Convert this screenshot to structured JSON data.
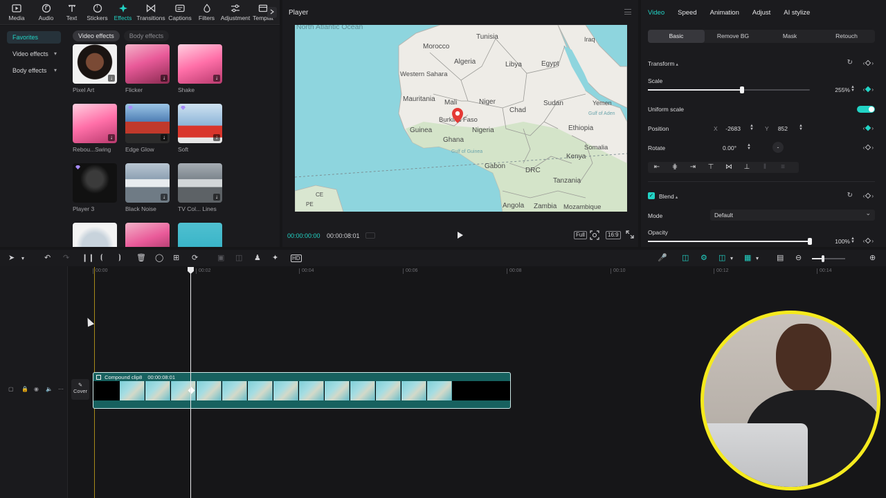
{
  "toolbar": {
    "items": [
      {
        "label": "Media",
        "icon": "media-icon"
      },
      {
        "label": "Audio",
        "icon": "audio-icon"
      },
      {
        "label": "Text",
        "icon": "text-icon"
      },
      {
        "label": "Stickers",
        "icon": "stickers-icon"
      },
      {
        "label": "Effects",
        "icon": "effects-icon",
        "active": true
      },
      {
        "label": "Transitions",
        "icon": "transitions-icon"
      },
      {
        "label": "Captions",
        "icon": "captions-icon"
      },
      {
        "label": "Filters",
        "icon": "filters-icon"
      },
      {
        "label": "Adjustment",
        "icon": "adjustment-icon"
      },
      {
        "label": "Templat",
        "icon": "templates-icon"
      }
    ]
  },
  "categories": {
    "favorites": "Favorites",
    "video_effects": "Video effects",
    "body_effects": "Body effects"
  },
  "effects": {
    "tabs": {
      "video": "Video effects",
      "body": "Body effects"
    },
    "items": [
      {
        "name": "Pixel Art"
      },
      {
        "name": "Flicker"
      },
      {
        "name": "Shake"
      },
      {
        "name": "Rebou...Swing"
      },
      {
        "name": "Edge Glow"
      },
      {
        "name": "Soft"
      },
      {
        "name": "Player 3"
      },
      {
        "name": "Black Noise"
      },
      {
        "name": "TV Col... Lines"
      },
      {
        "name": ""
      },
      {
        "name": ""
      },
      {
        "name": ""
      }
    ]
  },
  "player": {
    "title": "Player",
    "current_time": "00:00:00:00",
    "duration": "00:00:08:01",
    "buttons": {
      "full": "Full",
      "ratio": "16:9"
    },
    "map_labels": {
      "ocean": "North Atlantic Ocean",
      "tunisia": "Tunisia",
      "iraq": "Iraq",
      "morocco": "Morocco",
      "algeria": "Algeria",
      "libya": "Libya",
      "egypt": "Egypt",
      "western_sahara": "Western Sahara",
      "mauritania": "Mauritania",
      "mali": "Mali",
      "niger": "Niger",
      "chad": "Chad",
      "sudan": "Sudan",
      "yemen": "Yemen",
      "gulf_aden": "Gulf of Aden",
      "burkina": "Burkina Faso",
      "nigeria": "Nigeria",
      "ethiopia": "Ethiopia",
      "somalia": "Somalia",
      "guinea": "Guinea",
      "ghana": "Ghana",
      "gulf_guinea": "Gulf of Guinea",
      "kenya": "Kenya",
      "gabon": "Gabon",
      "drc": "DRC",
      "tanzania": "Tanzania",
      "angola": "Angola",
      "zambia": "Zambia",
      "mozambique": "Mozambique",
      "ce": "CE",
      "pe": "PE"
    }
  },
  "inspector": {
    "tabs": [
      "Video",
      "Speed",
      "Animation",
      "Adjust",
      "AI stylize"
    ],
    "sub_tabs": [
      "Basic",
      "Remove BG",
      "Mask",
      "Retouch"
    ],
    "transform": "Transform",
    "scale_label": "Scale",
    "scale_value": "255%",
    "scale_fraction": 0.58,
    "uniform_scale": "Uniform scale",
    "position_label": "Position",
    "x_label": "X",
    "x_value": "-2683",
    "y_label": "Y",
    "y_value": "852",
    "rotate_label": "Rotate",
    "rotate_value": "0.00°",
    "rotate_dash": "-",
    "blend": "Blend",
    "mode_label": "Mode",
    "mode_value": "Default",
    "opacity_label": "Opacity",
    "opacity_value": "100%",
    "opacity_fraction": 1.0
  },
  "timeline": {
    "ticks": [
      "00:00",
      "00:02",
      "00:04",
      "00:06",
      "00:08",
      "00:10",
      "00:12",
      "00:14"
    ],
    "cover_label": "Cover",
    "clip_name": "Compound clip8",
    "clip_duration": "00:00:08:01"
  },
  "colors": {
    "accent": "#22d3c5",
    "clip": "#17615f",
    "webcam_border": "#f5ea1e"
  }
}
